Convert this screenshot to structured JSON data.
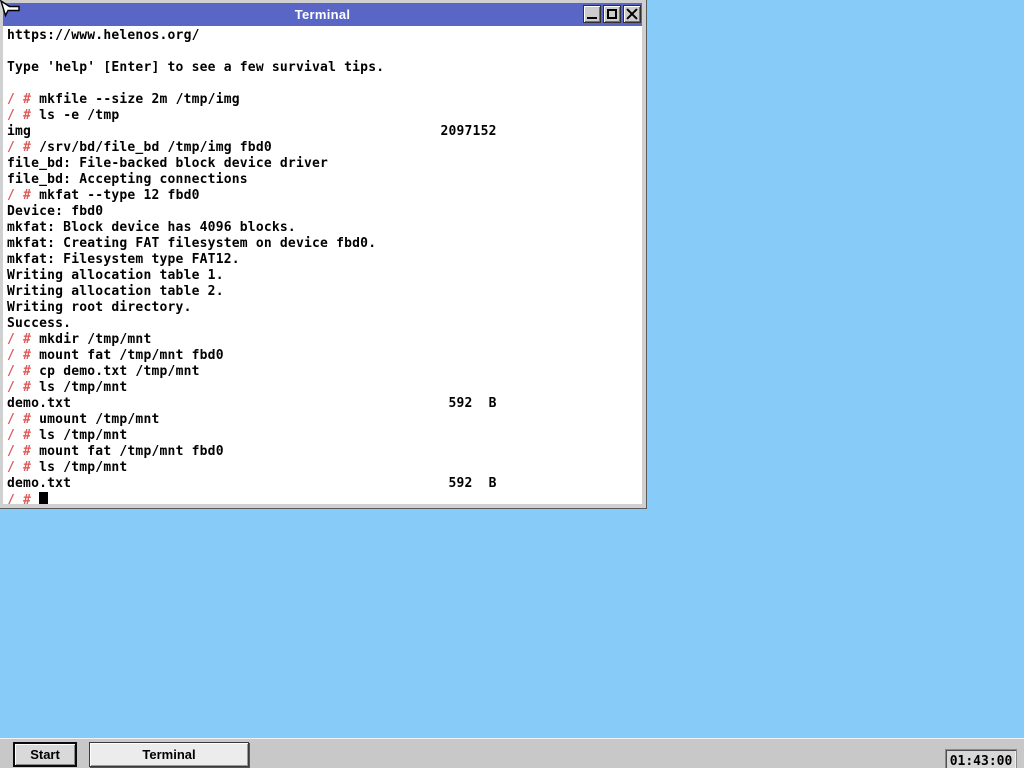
{
  "desktop": {
    "background_color": "#87CBF8"
  },
  "window": {
    "title": "Terminal",
    "titlebar_color": "#5A66C6",
    "controls": [
      {
        "name": "minimize-icon"
      },
      {
        "name": "maximize-icon"
      },
      {
        "name": "close-icon"
      }
    ]
  },
  "terminal": {
    "prompt": "/ # ",
    "prompt_color": "#E05C5C",
    "lines": [
      {
        "t": "out",
        "text": "https://www.helenos.org/"
      },
      {
        "t": "out",
        "text": ""
      },
      {
        "t": "out",
        "text": "Type 'help' [Enter] to see a few survival tips."
      },
      {
        "t": "out",
        "text": ""
      },
      {
        "t": "cmd",
        "text": "mkfile --size 2m /tmp/img"
      },
      {
        "t": "cmd",
        "text": "ls -e /tmp"
      },
      {
        "t": "out",
        "text": "img                                                   2097152"
      },
      {
        "t": "cmd",
        "text": "/srv/bd/file_bd /tmp/img fbd0"
      },
      {
        "t": "out",
        "text": "file_bd: File-backed block device driver"
      },
      {
        "t": "out",
        "text": "file_bd: Accepting connections"
      },
      {
        "t": "cmd",
        "text": "mkfat --type 12 fbd0"
      },
      {
        "t": "out",
        "text": "Device: fbd0"
      },
      {
        "t": "out",
        "text": "mkfat: Block device has 4096 blocks."
      },
      {
        "t": "out",
        "text": "mkfat: Creating FAT filesystem on device fbd0."
      },
      {
        "t": "out",
        "text": "mkfat: Filesystem type FAT12."
      },
      {
        "t": "out",
        "text": "Writing allocation table 1."
      },
      {
        "t": "out",
        "text": "Writing allocation table 2."
      },
      {
        "t": "out",
        "text": "Writing root directory."
      },
      {
        "t": "out",
        "text": "Success."
      },
      {
        "t": "cmd",
        "text": "mkdir /tmp/mnt"
      },
      {
        "t": "cmd",
        "text": "mount fat /tmp/mnt fbd0"
      },
      {
        "t": "cmd",
        "text": "cp demo.txt /tmp/mnt"
      },
      {
        "t": "cmd",
        "text": "ls /tmp/mnt"
      },
      {
        "t": "out",
        "text": "demo.txt                                               592  B"
      },
      {
        "t": "cmd",
        "text": "umount /tmp/mnt"
      },
      {
        "t": "cmd",
        "text": "ls /tmp/mnt"
      },
      {
        "t": "cmd",
        "text": "mount fat /tmp/mnt fbd0"
      },
      {
        "t": "cmd",
        "text": "ls /tmp/mnt"
      },
      {
        "t": "out",
        "text": "demo.txt                                               592  B"
      },
      {
        "t": "cursor",
        "text": ""
      }
    ]
  },
  "taskbar": {
    "start_label": "Start",
    "tasks": [
      {
        "label": "Terminal"
      }
    ],
    "clock": "01:43:00"
  }
}
